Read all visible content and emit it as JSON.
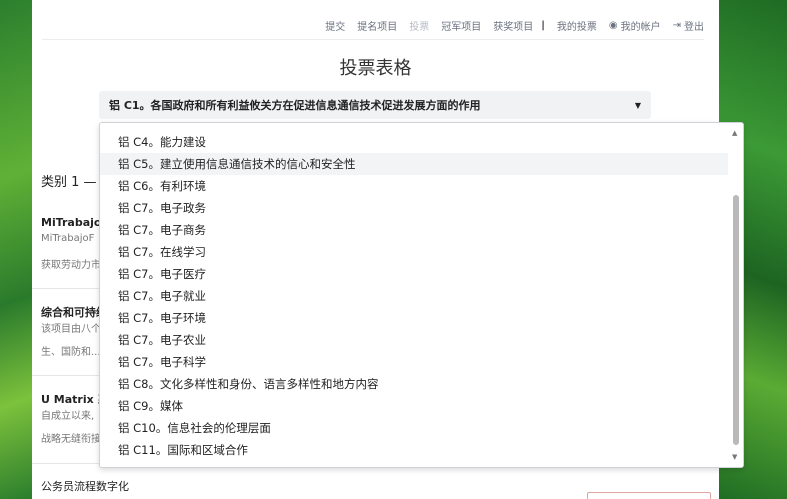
{
  "nav": {
    "items": [
      {
        "label": "提交",
        "active": false
      },
      {
        "label": "提名项目",
        "active": false
      },
      {
        "label": "投票",
        "active": true
      },
      {
        "label": "冠军项目",
        "active": false
      },
      {
        "label": "获奖项目",
        "active": false
      }
    ],
    "separator": "|",
    "my_votes": "我的投票",
    "my_account": "我的帐户",
    "logout": "登出"
  },
  "page_title": "投票表格",
  "select": {
    "value": "铝 C1。各国政府和所有利益攸关方在促进信息通信技术促进发展方面的作用"
  },
  "dropdown": {
    "options": [
      "铝 C4。能力建设",
      "铝 C5。建立使用信息通信技术的信心和安全性",
      "铝 C6。有利环境",
      "铝 C7。电子政务",
      "铝 C7。电子商务",
      "铝 C7。在线学习",
      "铝 C7。电子医疗",
      "铝 C7。电子就业",
      "铝 C7。电子环境",
      "铝 C7。电子农业",
      "铝 C7。电子科学",
      "铝 C8。文化多样性和身份、语言多样性和地方内容",
      "铝 C9。媒体",
      "铝 C10。信息社会的伦理层面",
      "铝 C11。国际和区域合作"
    ],
    "hovered_index": 1
  },
  "category_label": "类别 1 — /",
  "entries": [
    {
      "title": "MiTrabajoF",
      "line1": "MiTrabajoF",
      "line2": "获取劳动力市"
    },
    {
      "title": "综合和可持续",
      "line1": "该项目由八个",
      "line2": "生、国防和..."
    },
    {
      "title": "U Matrix 系",
      "line1": "自成立以来,",
      "line2": "战略无缝衔接"
    },
    {
      "title": "公务员流程数字化",
      "line1": "",
      "line2": ""
    }
  ]
}
